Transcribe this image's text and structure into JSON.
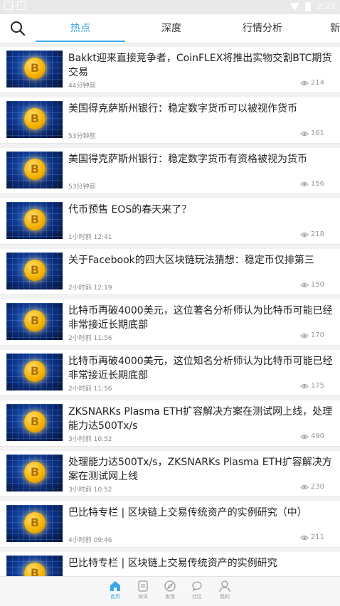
{
  "tabs": [
    "热点",
    "深度",
    "行情分析",
    "新"
  ],
  "articles": [
    {
      "title": "Bakkt迎来直接竞争者，CoinFLEX将推出实物交割BTC期货交易",
      "time": "44分钟前",
      "views": "214"
    },
    {
      "title": "美国得克萨斯州银行：稳定数字货币可以被视作货币",
      "time": "53分钟前",
      "views": "161"
    },
    {
      "title": "美国得克萨斯州银行：稳定数字货币有资格被视为货币",
      "time": "53分钟前",
      "views": "156"
    },
    {
      "title": "代币预售 EOS的春天来了？",
      "time": "1小时前 12:41",
      "views": "218"
    },
    {
      "title": "关于Facebook的四大区块链玩法猜想：稳定币仅排第三",
      "time": "2小时前 12:19",
      "views": "150"
    },
    {
      "title": "比特币再破4000美元，这位著名分析师认为比特币可能已经非常接近长期底部",
      "time": "2小时前 11:56",
      "views": "170"
    },
    {
      "title": "比特币再破4000美元，这位知名分析师认为比特币可能已经非常接近长期底部",
      "time": "2小时前 11:56",
      "views": "175"
    },
    {
      "title": "ZKSNARKs Plasma ETH扩容解决方案在测试网上线，处理能力达500Tx/s",
      "time": "3小时前 10:52",
      "views": "490"
    },
    {
      "title": "处理能力达500Tx/s，ZKSNARKs Plasma ETH扩容解决方案在测试网上线",
      "time": "3小时前 10:52",
      "views": "230"
    },
    {
      "title": "巴比特专栏 | 区块链上交易传统资产的实例研究（中）",
      "time": "4小时前 09:46",
      "views": "211"
    },
    {
      "title": "巴比特专栏 | 区块链上交易传统资产的实例研究",
      "time": "",
      "views": ""
    }
  ],
  "bottom_nav": [
    "首页",
    "快讯",
    "发现",
    "社区",
    "我的"
  ],
  "statusbar": {
    "time": "2:23"
  },
  "colors": {
    "accent": "#3aa8e8"
  }
}
